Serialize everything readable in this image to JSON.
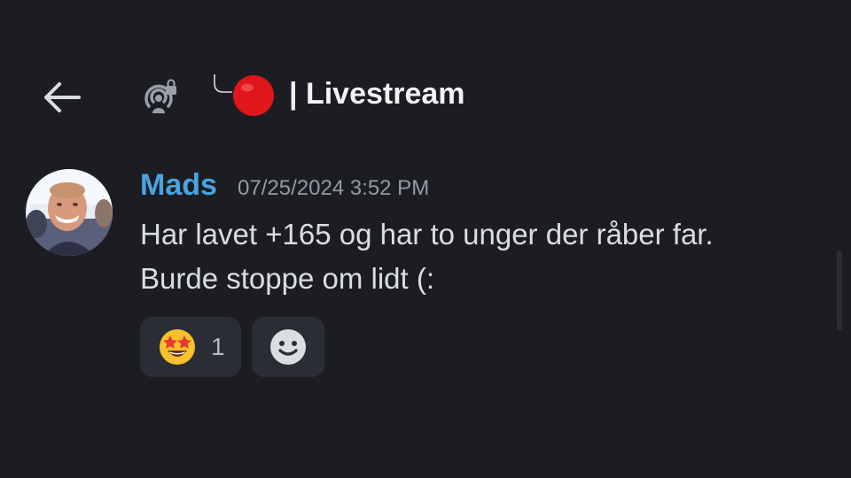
{
  "header": {
    "back_icon": "arrow-left-icon",
    "channel_icon": "locked-stage-broadcast-icon",
    "thread_icon": "thread-branch-icon",
    "status_icon": "red-circle-icon",
    "channel_name": "| Livestream"
  },
  "message": {
    "author": "Mads",
    "timestamp": "07/25/2024 3:52 PM",
    "lines": [
      "Har lavet +165 og har to unger der råber far.",
      "Burde stoppe om lidt  (:"
    ],
    "reactions": [
      {
        "emoji": "star-struck-emoji",
        "count": "1"
      }
    ],
    "add_reaction_icon": "add-reaction-smiley-icon"
  },
  "colors": {
    "background": "#1c1d22",
    "author": "#4aa3df",
    "reaction_bg": "#2b2d34",
    "status_red": "#e0161b"
  }
}
